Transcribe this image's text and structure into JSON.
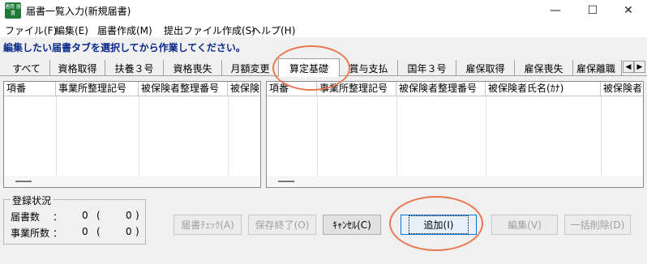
{
  "window": {
    "title": "届書一覧入力(新規届書)",
    "icon_text": "適用 届書",
    "controls": {
      "minimize": "—",
      "maximize": "☐",
      "close": "✕"
    }
  },
  "menu": [
    "ファイル(F)",
    "編集(E)",
    "届書作成(M)",
    "提出ファイル作成(S)",
    "ヘルプ(H)"
  ],
  "instruction": "編集したい届書タブを選択してから作業してください。",
  "tabs": [
    "すべて",
    "資格取得",
    "扶養３号",
    "資格喪失",
    "月額変更",
    "算定基礎",
    "賞与支払",
    "国年３号",
    "雇保取得",
    "雇保喪失",
    "雇保離職"
  ],
  "active_tab": "算定基礎",
  "tab_scroll": {
    "left": "◀",
    "right": "▶"
  },
  "left_grid": {
    "columns": [
      "項番",
      "事業所整理記号",
      "被保険者整理番号",
      "被保険"
    ]
  },
  "right_grid": {
    "columns": [
      "項番",
      "事業所整理記号",
      "被保険者整理番号",
      "被保険者氏名(ｶﾅ)",
      "被保険者"
    ]
  },
  "status": {
    "title": "登録状況",
    "rows": [
      {
        "label": "届書数",
        "colon": "：",
        "count": "0",
        "open": "(",
        "value": "0",
        "close": ")"
      },
      {
        "label": "事業所数",
        "colon": "：",
        "count": "0",
        "open": "(",
        "value": "0",
        "close": ")"
      }
    ]
  },
  "buttons": {
    "check": "届書ﾁｪｯｸ(A)",
    "save_end": "保存終了(O)",
    "cancel": "ｷｬﾝｾﾙ(C)",
    "add": "追加(I)",
    "edit": "編集(V)",
    "bulk_delete": "一括削除(D)"
  },
  "colors": {
    "instruction": "#0a2a8a",
    "highlight": "#e87852",
    "focus": "#0078d7"
  }
}
